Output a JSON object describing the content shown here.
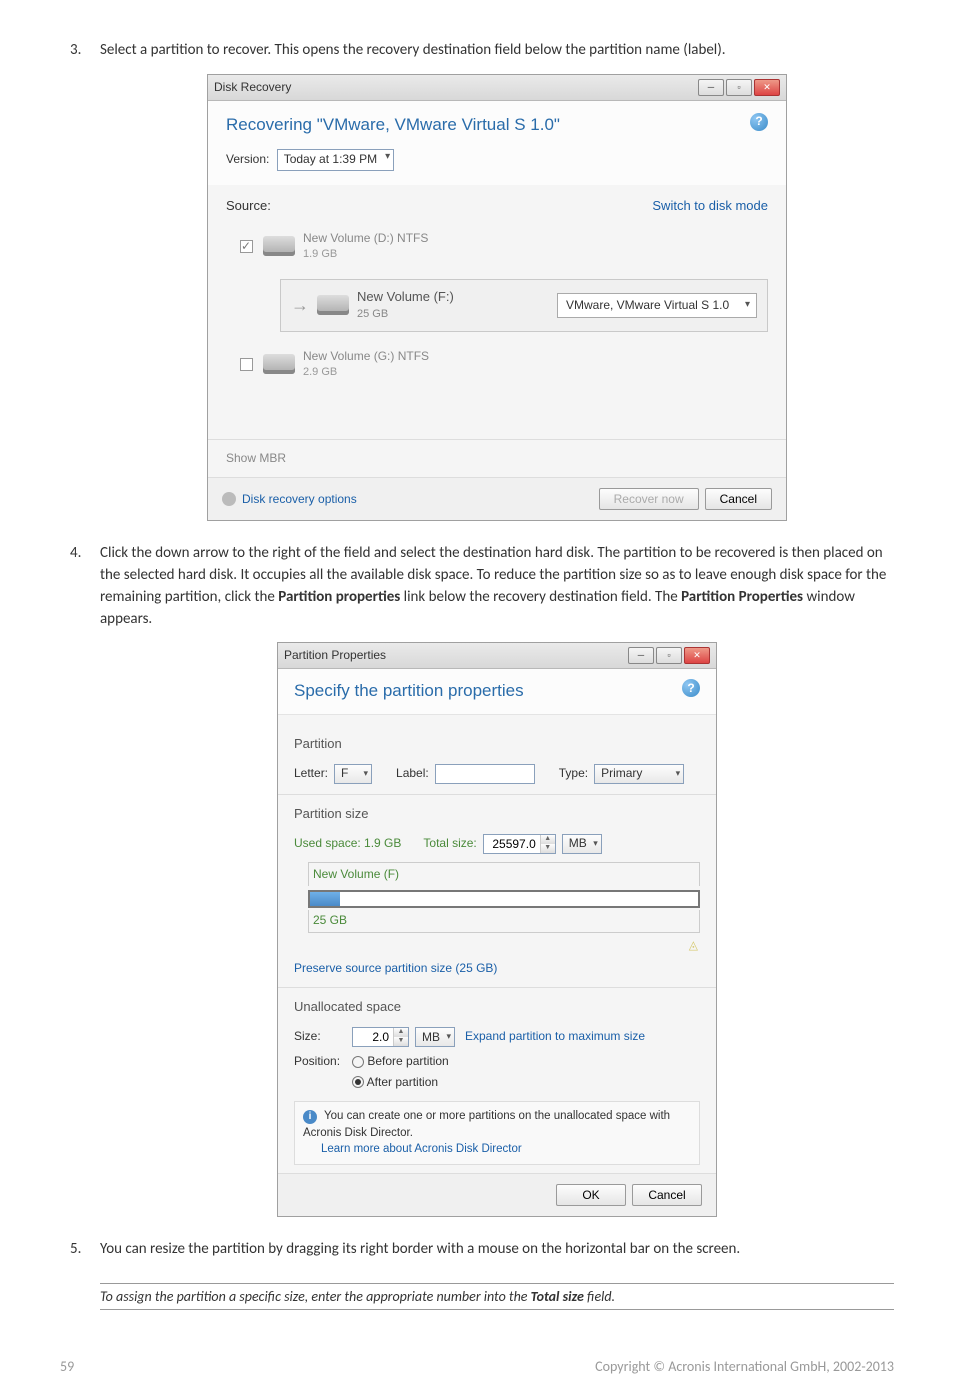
{
  "step3": {
    "text": "Select a partition to recover. This opens the recovery destination field below the partition name (label)."
  },
  "disk_recovery": {
    "window_title": "Disk Recovery",
    "title": "Recovering \"VMware, VMware Virtual S 1.0\"",
    "version_label": "Version:",
    "version_value": "Today at 1:39 PM",
    "source_label": "Source:",
    "switch_link": "Switch to disk mode",
    "volumes": [
      {
        "name": "New Volume (D:)  NTFS",
        "size": "1.9 GB",
        "checked": true
      },
      {
        "name": "New Volume (G:)  NTFS",
        "size": "2.9 GB",
        "checked": false
      }
    ],
    "selected_vol": {
      "name": "New Volume (F:)",
      "size": "25 GB"
    },
    "destination": "VMware, VMware Virtual S 1.0",
    "show_mbr": "Show MBR",
    "options_link": "Disk recovery options",
    "recover_btn": "Recover now",
    "cancel_btn": "Cancel"
  },
  "step4": {
    "text_a": "Click the down arrow to the right of the field and select the destination hard disk. The partition to be recovered is then placed on the selected hard disk. It occupies all the available disk space. To reduce the partition size so as to leave enough disk space for the remaining partition, click the ",
    "strong1": "Partition properties",
    "text_b": " link below the recovery destination field. The ",
    "strong2": "Partition Properties",
    "text_c": " window appears."
  },
  "partition_props": {
    "window_title": "Partition Properties",
    "title": "Specify the partition properties",
    "partition_section": "Partition",
    "letter_label": "Letter:",
    "letter_value": "F",
    "label_label": "Label:",
    "label_value": "",
    "type_label": "Type:",
    "type_value": "Primary",
    "size_section": "Partition size",
    "used_space": "Used space: 1.9 GB",
    "total_label": "Total size:",
    "total_value": "25597.0",
    "total_unit": "MB",
    "diagram_label": "New Volume (F)",
    "diagram_size": "25 GB",
    "preserve_link": "Preserve source partition size (25 GB)",
    "unalloc_section": "Unallocated space",
    "size_label": "Size:",
    "size_value": "2.0",
    "size_unit": "MB",
    "expand_link": "Expand partition to maximum size",
    "position_label": "Position:",
    "pos_before": "Before partition",
    "pos_after": "After partition",
    "info_text": "You can create one or more partitions on the unallocated space with Acronis Disk Director.",
    "learn_link": "Learn more about Acronis Disk Director",
    "ok_btn": "OK",
    "cancel_btn": "Cancel"
  },
  "step5": {
    "text": "You can resize the partition by dragging its right border with a mouse on the horizontal bar on the screen.",
    "note_a": "To assign the partition a specific size, enter the appropriate number into the ",
    "note_strong": "Total size",
    "note_b": " field."
  },
  "footer": {
    "page": "59",
    "copyright": "Copyright © Acronis International GmbH, 2002-2013"
  }
}
